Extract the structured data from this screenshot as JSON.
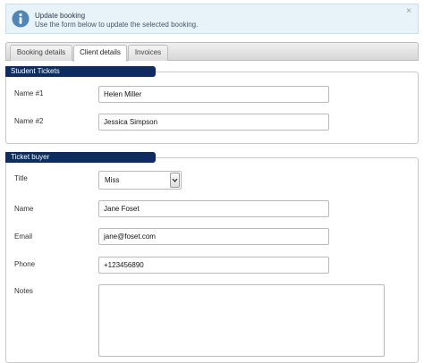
{
  "info": {
    "title": "Update booking",
    "subtitle": "Use the form below to update the selected booking.",
    "close": "×",
    "icon": "info-icon"
  },
  "tabs": [
    {
      "label": "Booking details",
      "active": false
    },
    {
      "label": "Client details",
      "active": true
    },
    {
      "label": "Invoices",
      "active": false
    }
  ],
  "student_tickets": {
    "legend": "Student Tickets",
    "name1_label": "Name #1",
    "name1_value": "Helen Miller",
    "name2_label": "Name #2",
    "name2_value": "Jessica Simpson"
  },
  "ticket_buyer": {
    "legend": "Ticket buyer",
    "title_label": "Title",
    "title_value": "Miss",
    "name_label": "Name",
    "name_value": "Jane Foset",
    "email_label": "Email",
    "email_value": "jane@foset.com",
    "phone_label": "Phone",
    "phone_value": "+123456890",
    "notes_label": "Notes",
    "notes_value": ""
  },
  "colors": {
    "legend_bg": "#0e2d5e",
    "info_bg": "#e7f2f9",
    "info_icon": "#4f86b8"
  }
}
